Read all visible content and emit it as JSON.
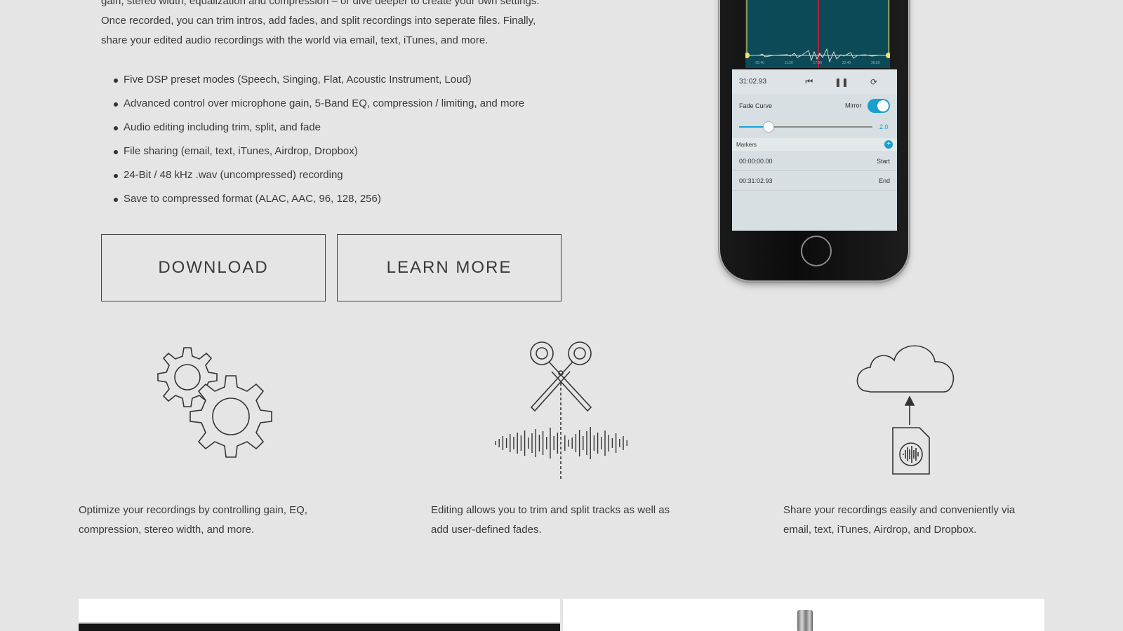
{
  "intro": {
    "lines": [
      "gain, stereo width, equalization and compression – or dive deeper to create your own settings.",
      "Once recorded, you can trim intros, add fades, and split recordings into seperate files. Finally,",
      "share your edited audio recordings with the world via email, text, iTunes, and more."
    ]
  },
  "features_list": [
    "Five DSP preset modes (Speech, Singing, Flat, Acoustic Instrument, Loud)",
    "Advanced control over microphone gain, 5-Band EQ, compression / limiting, and more",
    "Audio editing including trim, split, and fade",
    "File sharing (email, text, iTunes, Airdrop, Dropbox)",
    "24-Bit / 48 kHz .wav (uncompressed) recording",
    "Save to compressed format (ALAC, AAC, 96, 128, 256)"
  ],
  "buttons": {
    "download": "DOWNLOAD",
    "learn_more": "LEARN MORE"
  },
  "phone": {
    "wave_ticks": [
      "05:40",
      "11:20",
      "17:00",
      "22:40",
      "28:20"
    ],
    "time": "31:02.93",
    "fade_curve_label": "Fade Curve",
    "mirror_label": "Mirror",
    "slider_value": "2.0",
    "slider_fraction": 0.22,
    "markers_label": "Markers",
    "markers": [
      {
        "time": "00:00:00.00",
        "label": "Start"
      },
      {
        "time": "00:31:02.93",
        "label": "End"
      }
    ],
    "accent_color": "#1a9fd0"
  },
  "columns": [
    {
      "icon": "gears-icon",
      "text": "Optimize your recordings by controlling gain, EQ, compression, stereo width, and more."
    },
    {
      "icon": "scissors-waveform-icon",
      "text": "Editing allows you to trim and split tracks as well as add user-defined fades."
    },
    {
      "icon": "cloud-upload-file-icon",
      "text": "Share your recordings easily and conveniently via email, text, iTunes, Airdrop, and Dropbox."
    }
  ]
}
